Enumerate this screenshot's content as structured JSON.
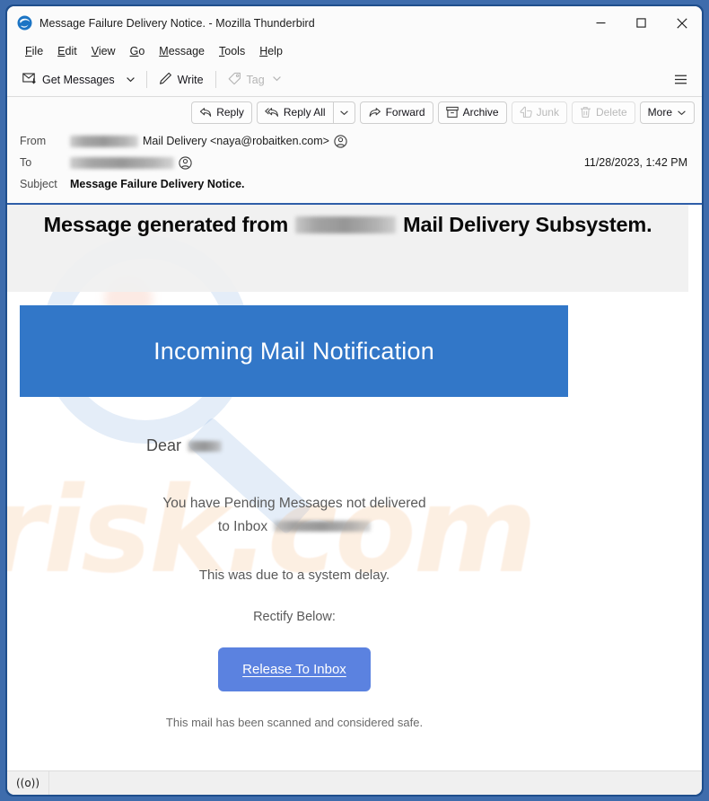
{
  "window": {
    "title": "Message Failure Delivery Notice. - Mozilla Thunderbird",
    "app_icon": "thunderbird-icon",
    "controls": {
      "minimize": "minimize-icon",
      "maximize": "maximize-icon",
      "close": "close-icon"
    }
  },
  "menubar": {
    "items": [
      {
        "label": "File",
        "accel": "F"
      },
      {
        "label": "Edit",
        "accel": "E"
      },
      {
        "label": "View",
        "accel": "V"
      },
      {
        "label": "Go",
        "accel": "G"
      },
      {
        "label": "Message",
        "accel": "M"
      },
      {
        "label": "Tools",
        "accel": "T"
      },
      {
        "label": "Help",
        "accel": "H"
      }
    ]
  },
  "toolbar": {
    "get_messages_label": "Get Messages",
    "write_label": "Write",
    "tag_label": "Tag",
    "menu_icon": "hamburger-icon"
  },
  "message_actions": {
    "reply": "Reply",
    "reply_all": "Reply All",
    "forward": "Forward",
    "archive": "Archive",
    "junk": "Junk",
    "delete": "Delete",
    "more": "More"
  },
  "headers": {
    "from_label": "From",
    "from_value": "Mail Delivery <naya@robaitken.com>",
    "from_redacted": true,
    "to_label": "To",
    "to_value": "",
    "to_redacted": true,
    "subject_label": "Subject",
    "subject_value": "Message Failure Delivery Notice.",
    "date": "11/28/2023, 1:42 PM"
  },
  "email": {
    "headline_before": "Message generated from",
    "headline_after": "Mail Delivery Subsystem.",
    "banner_text": "Incoming Mail Notification",
    "greeting": "Dear",
    "pending_line1": "You have Pending Messages not delivered",
    "pending_line2": "to Inbox",
    "delay_text": "This was due to a system delay.",
    "rectify_text": "Rectify Below:",
    "cta_label": "Release To Inbox",
    "footer_text": "This mail has been scanned and considered safe.",
    "watermark_text": "risk.com",
    "banner_color": "#3277C8",
    "cta_color": "#5B82E0"
  },
  "statusbar": {
    "indicator_icon": "online-status-icon",
    "indicator_glyph": "((o))"
  }
}
